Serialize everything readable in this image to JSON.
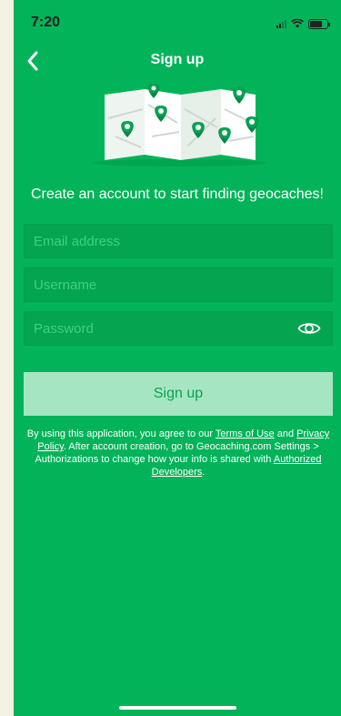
{
  "status_bar": {
    "time": "7:20"
  },
  "nav": {
    "title": "Sign up",
    "back_icon": "chevron-left-icon"
  },
  "headline": "Create an account to start finding geocaches!",
  "form": {
    "email_placeholder": "Email address",
    "email_value": "",
    "username_placeholder": "Username",
    "username_value": "",
    "password_placeholder": "Password",
    "password_value": "",
    "password_toggle_icon": "eye-icon"
  },
  "signup_button_label": "Sign up",
  "legal": {
    "prefix": "By using this application, you agree to our ",
    "terms_link": "Terms of Use",
    "and": " and ",
    "privacy_link": "Privacy Policy",
    "middle": ". After account creation, go to Geocaching.com Settings > Authorizations to change how your info is shared with ",
    "developers_link": "Authorized Developers",
    "suffix": "."
  },
  "colors": {
    "background": "#02b35a",
    "field_background": "#03a551",
    "placeholder": "#3fd07f",
    "button_background": "#a6e5c1",
    "button_text": "#04a54f"
  }
}
